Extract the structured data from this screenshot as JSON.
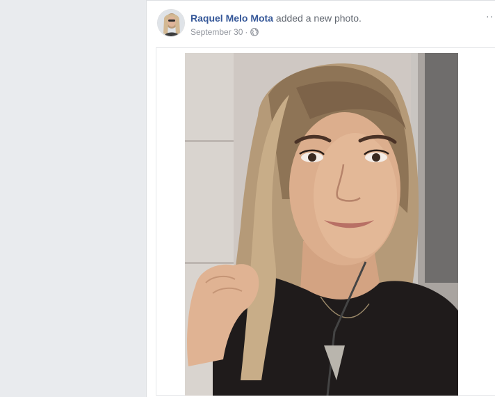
{
  "post": {
    "author": "Raquel Melo Mota",
    "action": "added a new photo.",
    "timestamp": "September 30",
    "separator": "·",
    "privacy_icon": "globe-icon",
    "more_icon": "more-options-icon",
    "more_label": "··"
  },
  "photo": {
    "subject": "selfie"
  }
}
